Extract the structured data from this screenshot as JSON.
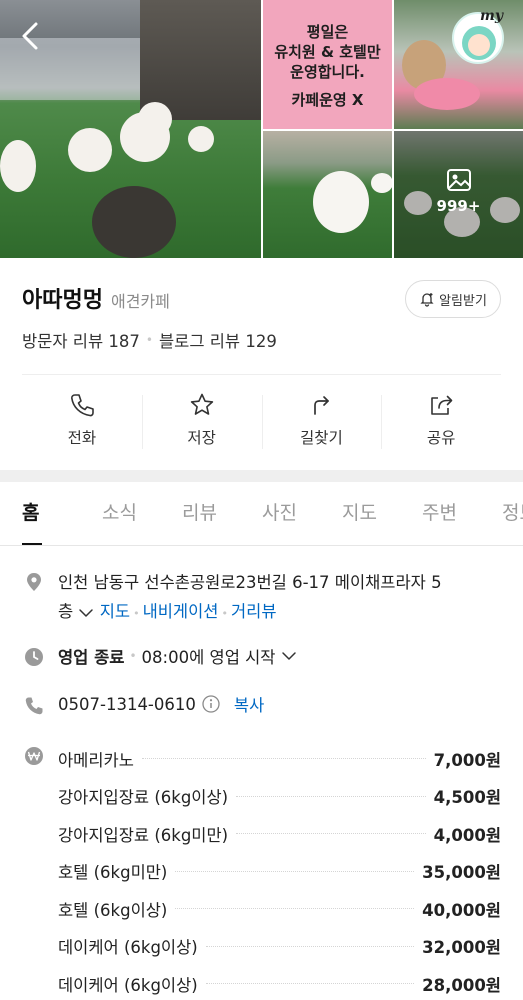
{
  "gallery": {
    "sign_lines": [
      "평일은",
      "유치원 & 호텔만",
      "운영합니다.",
      "카페운영 X"
    ],
    "avatar_label": "my",
    "more_photos": "999+"
  },
  "place": {
    "name": "아따멍멍",
    "category": "애견카페",
    "alarm_label": "알림받기",
    "visitor_reviews": "방문자 리뷰 187",
    "blog_reviews": "블로그 리뷰 129"
  },
  "actions": [
    {
      "label": "전화",
      "icon": "phone-icon"
    },
    {
      "label": "저장",
      "icon": "star-icon"
    },
    {
      "label": "길찾기",
      "icon": "directions-icon"
    },
    {
      "label": "공유",
      "icon": "share-icon"
    }
  ],
  "tabs": [
    "홈",
    "소식",
    "리뷰",
    "사진",
    "지도",
    "주변",
    "정보"
  ],
  "info": {
    "address_line1": "인천 남동구 선수촌공원로23번길 6-17 메이채프라자 5",
    "address_line2": "층",
    "map_link": "지도",
    "navi_link": "내비게이션",
    "street_link": "거리뷰",
    "status": "영업 종료",
    "opening": "08:00에 영업 시작",
    "phone": "0507-1314-0610",
    "copy_label": "복사"
  },
  "menu": [
    {
      "name": "아메리카노",
      "price": "7,000원"
    },
    {
      "name": "강아지입장료 (6kg이상)",
      "price": "4,500원"
    },
    {
      "name": "강아지입장료 (6kg미만)",
      "price": "4,000원"
    },
    {
      "name": "호텔 (6kg미만)",
      "price": "35,000원"
    },
    {
      "name": "호텔 (6kg이상)",
      "price": "40,000원"
    },
    {
      "name": "데이케어 (6kg이상)",
      "price": "32,000원"
    },
    {
      "name": "데이케어 (6kg이상)",
      "price": "28,000원"
    }
  ],
  "colors": {
    "link": "#0068c3",
    "sign_bg": "#f2a6bd",
    "separator": "#efefef"
  }
}
